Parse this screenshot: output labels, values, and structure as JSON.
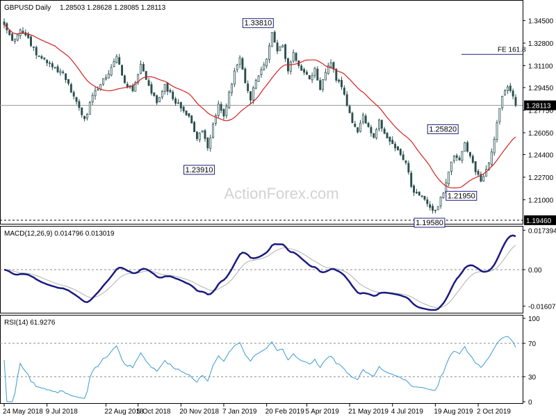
{
  "chart_data": [
    {
      "type": "candlestick",
      "panel": "price",
      "title": "GBPUSD Daily",
      "ohlc_readout": [
        "1.28503",
        "1.28628",
        "1.28085",
        "1.28113"
      ],
      "yaxis_ticks": [
        "1.34500",
        "1.32800",
        "1.31100",
        "1.29450",
        "1.27750",
        "1.26050",
        "1.24400",
        "1.22700",
        "1.21000"
      ],
      "ylim": [
        1.194,
        1.35
      ],
      "current_price": {
        "value": 1.28113,
        "label": "1.28113"
      },
      "support_line": {
        "value": 1.1946,
        "label": "1.19460"
      },
      "fe_line": {
        "value": 1.3195,
        "label": "FE 161.8"
      },
      "annotations": [
        {
          "label": "1.33810",
          "value": 1.3381,
          "x_index": 100
        },
        {
          "label": "1.23910",
          "value": 1.2391,
          "x_index": 78
        },
        {
          "label": "1.25820",
          "value": 1.2582,
          "x_index": 169
        },
        {
          "label": "1.21950",
          "value": 1.2195,
          "x_index": 165
        },
        {
          "label": "1.19580",
          "value": 1.1958,
          "x_index": 164
        }
      ],
      "x_ticks": [
        {
          "label": "24 May 2018",
          "index": 0
        },
        {
          "label": "9 Jul 2018",
          "index": 16
        },
        {
          "label": "22 Aug 2018",
          "index": 38
        },
        {
          "label": "5 Oct 2018",
          "index": 50
        },
        {
          "label": "20 Nov 2018",
          "index": 66
        },
        {
          "label": "7 Jan 2019",
          "index": 82
        },
        {
          "label": "20 Feb 2019",
          "index": 98
        },
        {
          "label": "5 Apr 2019",
          "index": 113
        },
        {
          "label": "21 May 2019",
          "index": 129
        },
        {
          "label": "4 Jul 2019",
          "index": 145
        },
        {
          "label": "19 Aug 2019",
          "index": 161
        },
        {
          "label": "2 Oct 2019",
          "index": 177
        }
      ],
      "close_anchors": [
        [
          0,
          1.342
        ],
        [
          3,
          1.33
        ],
        [
          6,
          1.338
        ],
        [
          9,
          1.332
        ],
        [
          12,
          1.319
        ],
        [
          15,
          1.316
        ],
        [
          18,
          1.31
        ],
        [
          22,
          1.306
        ],
        [
          26,
          1.288
        ],
        [
          30,
          1.271
        ],
        [
          34,
          1.292
        ],
        [
          38,
          1.302
        ],
        [
          42,
          1.318
        ],
        [
          45,
          1.298
        ],
        [
          48,
          1.292
        ],
        [
          51,
          1.312
        ],
        [
          54,
          1.296
        ],
        [
          57,
          1.283
        ],
        [
          60,
          1.297
        ],
        [
          63,
          1.286
        ],
        [
          66,
          1.279
        ],
        [
          69,
          1.273
        ],
        [
          72,
          1.256
        ],
        [
          74,
          1.262
        ],
        [
          76,
          1.249
        ],
        [
          78,
          1.267
        ],
        [
          80,
          1.282
        ],
        [
          82,
          1.273
        ],
        [
          84,
          1.291
        ],
        [
          86,
          1.307
        ],
        [
          88,
          1.317
        ],
        [
          90,
          1.298
        ],
        [
          92,
          1.285
        ],
        [
          94,
          1.3
        ],
        [
          96,
          1.308
        ],
        [
          98,
          1.316
        ],
        [
          100,
          1.336
        ],
        [
          102,
          1.322
        ],
        [
          104,
          1.326
        ],
        [
          106,
          1.307
        ],
        [
          108,
          1.321
        ],
        [
          110,
          1.311
        ],
        [
          112,
          1.306
        ],
        [
          114,
          1.301
        ],
        [
          116,
          1.309
        ],
        [
          118,
          1.293
        ],
        [
          120,
          1.306
        ],
        [
          122,
          1.313
        ],
        [
          124,
          1.3
        ],
        [
          126,
          1.295
        ],
        [
          128,
          1.281
        ],
        [
          130,
          1.268
        ],
        [
          132,
          1.261
        ],
        [
          134,
          1.274
        ],
        [
          136,
          1.265
        ],
        [
          138,
          1.257
        ],
        [
          140,
          1.27
        ],
        [
          142,
          1.26
        ],
        [
          144,
          1.254
        ],
        [
          146,
          1.249
        ],
        [
          148,
          1.244
        ],
        [
          150,
          1.238
        ],
        [
          152,
          1.22
        ],
        [
          154,
          1.215
        ],
        [
          156,
          1.213
        ],
        [
          158,
          1.207
        ],
        [
          160,
          1.202
        ],
        [
          162,
          1.205
        ],
        [
          164,
          1.215
        ],
        [
          166,
          1.231
        ],
        [
          168,
          1.243
        ],
        [
          170,
          1.24
        ],
        [
          172,
          1.253
        ],
        [
          174,
          1.243
        ],
        [
          176,
          1.231
        ],
        [
          178,
          1.224
        ],
        [
          180,
          1.233
        ],
        [
          182,
          1.246
        ],
        [
          184,
          1.268
        ],
        [
          186,
          1.288
        ],
        [
          188,
          1.295
        ],
        [
          190,
          1.288
        ],
        [
          191,
          1.281
        ]
      ],
      "series": [
        {
          "name": "",
          "color": "#2a4f4f",
          "style": "candles"
        },
        {
          "name": "",
          "color": "#d42020",
          "style": "moving-average",
          "period": 20
        }
      ]
    },
    {
      "type": "line",
      "panel": "macd",
      "title": "MACD(12,26,9) 0.014796 0.013019",
      "yaxis_ticks": [
        "0.017394",
        "0.00",
        "-0.016078"
      ],
      "ylim": [
        -0.0178,
        0.0178
      ],
      "series": [
        {
          "name": "",
          "color": "#1a1a80",
          "width": 2.5,
          "role": "macd"
        },
        {
          "name": "",
          "color": "#b0b0b0",
          "width": 1,
          "role": "signal"
        }
      ]
    },
    {
      "type": "line",
      "panel": "rsi",
      "title": "RSI(14) 61.9276",
      "yaxis_ticks": [
        "100",
        "70",
        "30",
        "0"
      ],
      "ylim": [
        0,
        100
      ],
      "levels": [
        70,
        30
      ],
      "series": [
        {
          "name": "",
          "color": "#3a9ad0",
          "width": 1
        }
      ]
    }
  ],
  "watermark": "ActionForex.com",
  "colors": {
    "background": "#ffffff",
    "grid": "#000000",
    "candle": "#2a4f4f",
    "moving_average": "#d42020",
    "macd": "#1a1a80",
    "signal": "#b0b0b0",
    "rsi": "#3a9ad0",
    "label_box_border": "#1a1a80"
  }
}
